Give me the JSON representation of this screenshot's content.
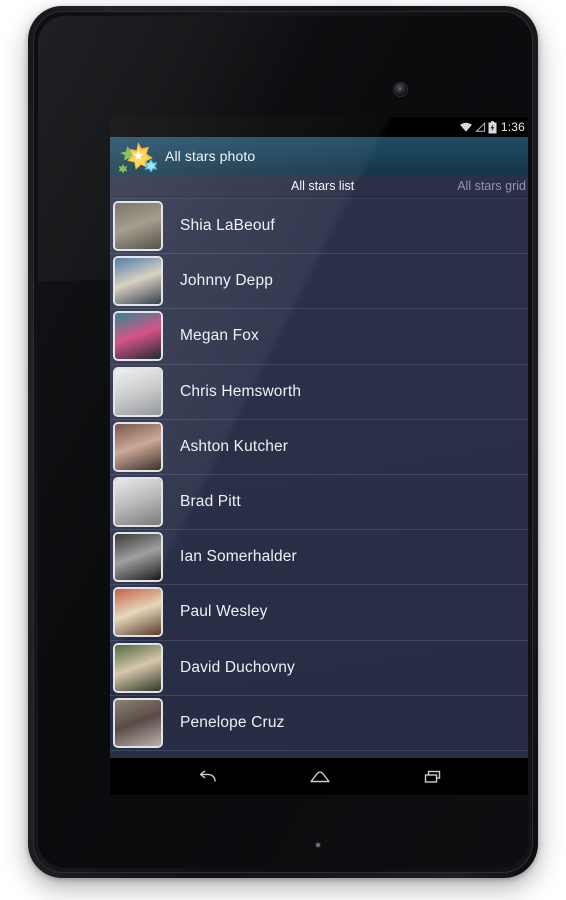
{
  "device": {
    "type": "android-tablet",
    "camera_icon": "front-camera",
    "led_icon": "notification-led"
  },
  "status_bar": {
    "time": "1:36",
    "icons": [
      "wifi-icon",
      "signal-icon",
      "battery-charging-icon"
    ]
  },
  "action_bar": {
    "app_icon": "stars-burst-icon",
    "title": "All stars photo",
    "background_color": "#1b4259"
  },
  "tabs": [
    {
      "label": "All stars list",
      "active": true
    },
    {
      "label": "All stars grid",
      "active": false
    }
  ],
  "list": {
    "background_color": "#2a3048",
    "divider_color": "#94a0be",
    "items": [
      {
        "name": "Shia LaBeouf",
        "thumb": "thumbnail-shia-labeouf"
      },
      {
        "name": "Johnny Depp",
        "thumb": "thumbnail-johnny-depp"
      },
      {
        "name": "Megan Fox",
        "thumb": "thumbnail-megan-fox"
      },
      {
        "name": "Chris Hemsworth",
        "thumb": "thumbnail-chris-hemsworth"
      },
      {
        "name": "Ashton Kutcher",
        "thumb": "thumbnail-ashton-kutcher"
      },
      {
        "name": "Brad Pitt",
        "thumb": "thumbnail-brad-pitt"
      },
      {
        "name": "Ian Somerhalder",
        "thumb": "thumbnail-ian-somerhalder"
      },
      {
        "name": "Paul Wesley",
        "thumb": "thumbnail-paul-wesley"
      },
      {
        "name": "David Duchovny",
        "thumb": "thumbnail-david-duchovny"
      },
      {
        "name": "Penelope Cruz",
        "thumb": "thumbnail-penelope-cruz"
      }
    ]
  },
  "nav_bar": {
    "buttons": [
      {
        "icon": "back-icon"
      },
      {
        "icon": "home-icon"
      },
      {
        "icon": "recents-icon"
      }
    ]
  }
}
